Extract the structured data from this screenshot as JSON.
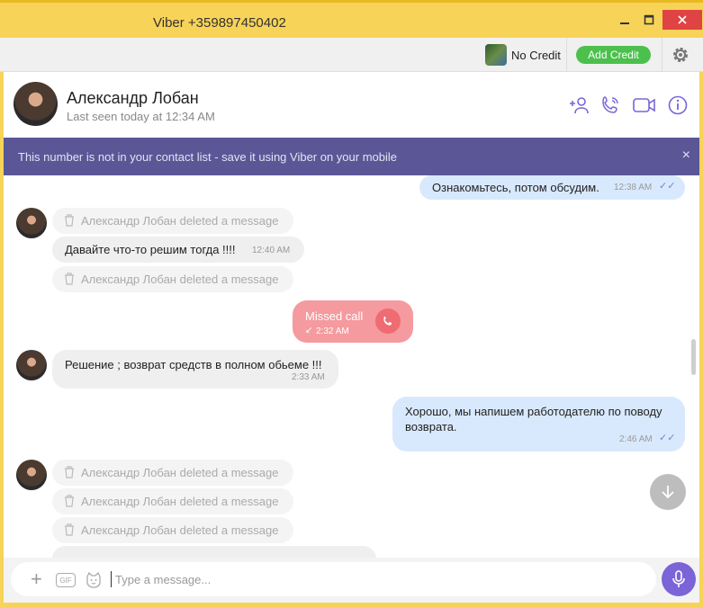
{
  "window": {
    "title": "Viber +359897450402"
  },
  "toolbar": {
    "credit_status": "No Credit",
    "add_credit_label": "Add Credit"
  },
  "contact": {
    "name": "Александр Лобан",
    "last_seen": "Last seen today at 12:34 AM"
  },
  "banner": {
    "text": "This number is not in your contact list - save it using Viber on your mobile",
    "close": "×"
  },
  "messages": [
    {
      "type": "out",
      "text": "Ознакомьтесь, потом обсудим.",
      "time": "12:38 AM",
      "ticks": "✓✓"
    },
    {
      "type": "deleted",
      "text": "Александр Лобан deleted a message"
    },
    {
      "type": "in",
      "text": "Давайте что-то решим тогда !!!!",
      "time": "12:40 AM"
    },
    {
      "type": "deleted",
      "text": "Александр Лобан deleted a message"
    },
    {
      "type": "missed",
      "text": "Missed call",
      "time": "2:32 AM",
      "arrow": "↙"
    },
    {
      "type": "in",
      "text": "Решение ; возврат средств в полном обьеме !!!",
      "time": "2:33 AM"
    },
    {
      "type": "out",
      "text": "Хорошо, мы напишем работодателю по поводу",
      "text2": "возврата.",
      "time": "2:46 AM",
      "ticks": "✓✓"
    },
    {
      "type": "deleted",
      "text": "Александр Лобан deleted a message"
    },
    {
      "type": "deleted",
      "text": "Александр Лобан deleted a message"
    },
    {
      "type": "deleted",
      "text": "Александр Лобан deleted a message"
    }
  ],
  "composer": {
    "placeholder": "Type a message...",
    "gif_label": "GIF"
  },
  "colors": {
    "accent": "#7a64d8",
    "banner": "#5b5796",
    "add_credit": "#4cc04c",
    "missed_call": "#f59a9e"
  }
}
